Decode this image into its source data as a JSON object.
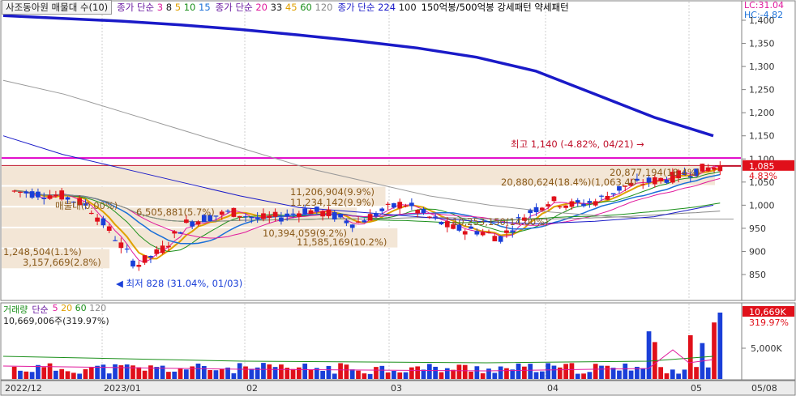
{
  "legend": {
    "stock": "사조동아원 매물대 수(10)",
    "ma1_label": "종가 단순",
    "ma1_periods": [
      "3",
      "8",
      "5",
      "10",
      "15"
    ],
    "ma1_colors": [
      "#e0189c",
      "#1a1a1a",
      "#e0a000",
      "#1a8f1a",
      "#1a6fd8"
    ],
    "ma2_label": "종가 단순",
    "ma2_periods": [
      "20",
      "33",
      "45",
      "60",
      "120"
    ],
    "ma2_colors": [
      "#e0189c",
      "#1a1a1a",
      "#e0a000",
      "#1a8f1a",
      "#888888"
    ],
    "ma3_label": "종가 단순",
    "ma3_periods": [
      "224",
      "100"
    ],
    "ma3_colors": [
      "#1a1ac8",
      "#1a1a1a"
    ],
    "pattern": "150억봉/500억봉 강세패턴  약세패턴",
    "lc": "LC:31.04",
    "hc": "HC:-4.82"
  },
  "vol_legend": {
    "label": "거래량",
    "ma_label": "단순",
    "periods": [
      "5",
      "20",
      "60",
      "120"
    ],
    "colors": [
      "#e0189c",
      "#e0a000",
      "#1a8f1a",
      "#888888"
    ],
    "value_text": "10,669,006주(319.97%)"
  },
  "annotations": {
    "high": "최고 1,140 (-4.82%, 04/21)",
    "low": "최저 828 (31.04%, 01/03)",
    "price_badge": "1,085",
    "price_pct": "4.83%",
    "vol_badge": "10,669K",
    "vol_pct": "319.97%",
    "profile_labels": [
      {
        "text": "20,877,194(18.4%)"
      },
      {
        "text": "20,880,624(18.4%)(1,063,40"
      },
      {
        "text": "11,206,904(9.9%)"
      },
      {
        "text": "11,234,142(9.9%)"
      },
      {
        "text": "매물대(0.00%)"
      },
      {
        "text": "6,505,881(5.7%)"
      },
      {
        "text": "10,394,059(9.2%)"
      },
      {
        "text": "11,585,169(10.2%)"
      },
      {
        "text": "10,253,150(14.00%)"
      },
      {
        "text": "1,248,504(1.1%)"
      },
      {
        "text": "3,157,669(2.8%)"
      }
    ]
  },
  "chart_data": {
    "type": "candlestick",
    "y_axis_ticks": [
      "1,400",
      "1,350",
      "1,300",
      "1,250",
      "1,200",
      "1,150",
      "1,100",
      "1,050",
      "1,000",
      "950",
      "900",
      "850"
    ],
    "y_range": [
      800,
      1410
    ],
    "x_axis_labels": [
      "2022/12",
      "2023/01",
      "02",
      "03",
      "04",
      "05",
      "05/08"
    ],
    "vol_axis_ticks": [
      "5,000K"
    ],
    "high": 1140,
    "low": 828,
    "last_close": 1085,
    "change_pct": 4.83,
    "last_volume": 10669006,
    "last_volume_pct": 319.97,
    "resistance_lines": [
      1102,
      1085
    ],
    "profile_bands": [
      {
        "price_low": 1040,
        "price_high": 1085,
        "volume": 20877194,
        "pct": 18.4
      },
      {
        "price_low": 995,
        "price_high": 1040,
        "volume": 11234142,
        "pct": 9.9
      },
      {
        "price_low": 950,
        "price_high": 995,
        "volume": 10394059,
        "pct": 9.2
      },
      {
        "price_low": 905,
        "price_high": 950,
        "volume": 11585169,
        "pct": 10.2
      },
      {
        "price_low": 860,
        "price_high": 905,
        "volume": 3157669,
        "pct": 2.8
      }
    ],
    "ma224": [
      1410,
      1404,
      1398,
      1390,
      1380,
      1368,
      1355,
      1340,
      1320,
      1290,
      1240,
      1190,
      1150
    ],
    "close_series": [
      1030,
      1025,
      1020,
      1000,
      940,
      870,
      900,
      960,
      975,
      985,
      970,
      975,
      990,
      980,
      960,
      985,
      1005,
      975,
      950,
      945,
      930,
      980,
      1010,
      1000,
      1010,
      1040,
      1050,
      1060,
      1075,
      1085
    ]
  }
}
